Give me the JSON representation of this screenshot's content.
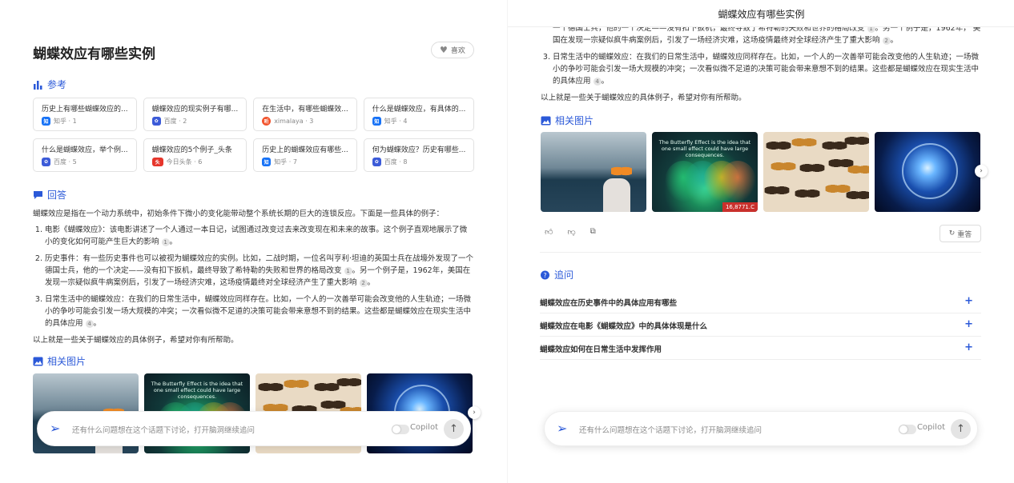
{
  "page_title": "蝴蝶效应有哪些实例",
  "like_label": "喜欢",
  "sections": {
    "references": "参考",
    "answer": "回答",
    "images": "相关图片",
    "followup": "追问"
  },
  "references": [
    {
      "title": "历史上有哪些蝴蝶效应的...",
      "source": "知乎 · 1",
      "icon": "zhihu",
      "color": "#1772f6",
      "glyph": "知"
    },
    {
      "title": "蝴蝶效应的现实例子有哪...",
      "source": "百度 · 2",
      "icon": "baidu",
      "color": "#3c5bd8",
      "glyph": "🐾"
    },
    {
      "title": "在生活中，有哪些蝴蝶效...",
      "source": "ximalaya · 3",
      "icon": "ximalaya",
      "color": "#f2542d",
      "glyph": "听"
    },
    {
      "title": "什么是蝴蝶效应，有具体的...",
      "source": "知乎 · 4",
      "icon": "zhihu",
      "color": "#1772f6",
      "glyph": "知"
    },
    {
      "title": "什么是蝴蝶效应，举个例...",
      "source": "百度 · 5",
      "icon": "baidu",
      "color": "#3c5bd8",
      "glyph": "🐾"
    },
    {
      "title": "蝴蝶效应的5个例子_头条",
      "source": "今日头条 · 6",
      "icon": "toutiao",
      "color": "#e6352b",
      "glyph": "头"
    },
    {
      "title": "历史上的蝴蝶效应有哪些...",
      "source": "知乎 · 7",
      "icon": "zhihu",
      "color": "#1772f6",
      "glyph": "知"
    },
    {
      "title": "何为蝴蝶效应？历史有哪些...",
      "source": "百度 · 8",
      "icon": "baidu",
      "color": "#3c5bd8",
      "glyph": "🐾"
    }
  ],
  "answer": {
    "intro": "蝴蝶效应是指在一个动力系统中，初始条件下微小的变化能带动整个系统长期的巨大的连锁反应。下面是一些具体的例子：",
    "items": [
      {
        "text": "电影《蝴蝶效应》：该电影讲述了一个人通过一本日记，试图通过改变过去来改变现在和未来的故事。这个例子直观地展示了微小的变化如何可能产生巨大的影响",
        "cite": "1"
      },
      {
        "text": "历史事件：有一些历史事件也可以被视为蝴蝶效应的实例。比如，二战时期，一位名叫亨利·坦迪的英国士兵在战壕外发现了一个德国士兵，他的一个决定——没有扣下扳机，最终导致了希特勒的失败和世界的格局改变",
        "cite": "1",
        "text2": "。另一个例子是，1962年，美国在发现一宗疑似疯牛病案例后，引发了一场经济灾难，这场疫情最终对全球经济产生了重大影响",
        "cite2": "2"
      },
      {
        "text": "日常生活中的蝴蝶效应：在我们的日常生活中，蝴蝶效应同样存在。比如，一个人的一次善举可能会改变他的人生轨迹；一场微小的争吵可能会引发一场大规模的冲突；一次看似微不足道的决策可能会带来意想不到的结果。这些都是蝴蝶效应在现实生活中的具体应用",
        "cite": "4"
      }
    ],
    "outro": "以上就是一些关于蝴蝶效应的具体例子，希望对你有所帮助。"
  },
  "right_top_fragment": {
    "line1": "一个德国士兵，他的一个决定——没有扣下扳机，最终导致了希特勒的失败和世界的格局改变",
    "cite1": "1",
    "line1b": "。另一个例子是，1962年，",
    "line2": "美国在发现一宗疑似疯牛病案例后，引发了一场经济灾难，这场疫情最终对全球经济产生了重大影响",
    "cite2": "2"
  },
  "images": {
    "img2_caption": "The Butterfly Effect is the idea that one small effect could have large consequences.",
    "img2_badge": "16,8771.C"
  },
  "regen_label": "重答",
  "followups": [
    "蝴蝶效应在历史事件中的具体应用有哪些",
    "蝴蝶效应在电影《蝴蝶效应》中的具体体现是什么",
    "蝴蝶效应如何在日常生活中发挥作用"
  ],
  "input": {
    "placeholder": "还有什么问题想在这个话题下讨论，打开脑洞继续追问",
    "copilot": "Copilot"
  },
  "colors": {
    "accent": "#2b59d8"
  }
}
